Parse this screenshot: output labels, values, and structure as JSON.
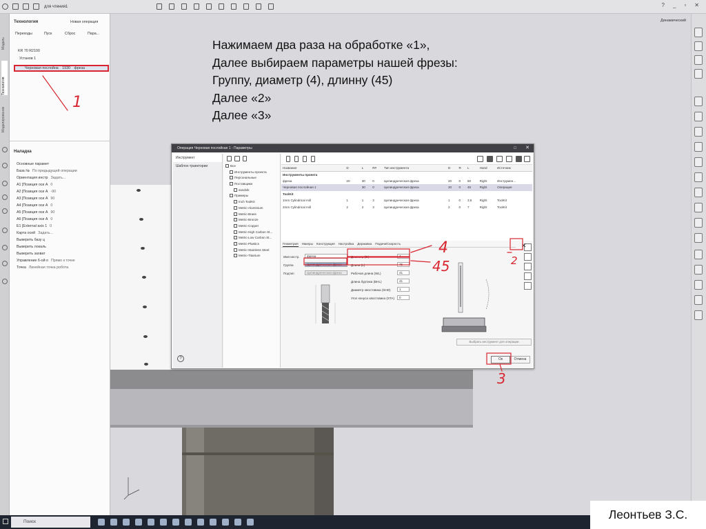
{
  "window": {
    "filename": "для чтения1",
    "mode_select": "Динамический"
  },
  "sidebar": {
    "tabs": [
      "Модель",
      "Технология",
      "Моделирование"
    ],
    "header": "Технология",
    "op_select": "Новая операция",
    "toolbar": [
      "Переходы",
      "Пуск",
      "Сброс",
      "Пара..."
    ],
    "tree": [
      "KR 70 R2100",
      "Установ 1",
      "Черновая послойна",
      "1930",
      "фреза"
    ],
    "setup_title": "Наладка",
    "setup_rows": [
      {
        "label": "Основные парамет",
        "value": ""
      },
      {
        "label": "База №",
        "value": "По предыдущей операции"
      },
      {
        "label": "Ориентация инстр",
        "value": "Задать..."
      },
      {
        "label": "A1 [Позиция оси A",
        "value": "0"
      },
      {
        "label": "A2 [Позиция оси A",
        "value": "-90"
      },
      {
        "label": "A3 [Позиция оси A",
        "value": "90"
      },
      {
        "label": "A4 [Позиция оси A",
        "value": "0"
      },
      {
        "label": "A5 [Позиция оси A",
        "value": "90"
      },
      {
        "label": "A6 [Позиция оси A",
        "value": "0"
      },
      {
        "label": "E1 [External axis 1",
        "value": "0"
      },
      {
        "label": "Карта осей",
        "value": "Задать..."
      },
      {
        "label": "Выверить базу ц",
        "value": ""
      },
      {
        "label": "Выверить локаль",
        "value": ""
      },
      {
        "label": "Выверить захват",
        "value": ""
      },
      {
        "label": "Управление 6-ой о",
        "value": "Прямо к точке"
      },
      {
        "label": "Точка",
        "value": "Линейная точка робота"
      }
    ]
  },
  "instructions": [
    "Нажимаем два раза на обработке «1»,",
    "Далее выбираем параметры нашей фрезы:",
    "Группу, диаметр (4), длинну (45)",
    "Далее «2»",
    "Далее «3»"
  ],
  "dialog": {
    "title": "Операция Черновая послойная 1 - Параметры",
    "left_items": [
      "Инструмент",
      "Шаблон траектории"
    ],
    "tree": [
      "Все",
      "Инструменты проекта",
      "Персональные",
      "Поставщики",
      "sandvik",
      "Примеры",
      "Inch ToolKit",
      "Metric-Aluminium",
      "Metric-Brass",
      "Metric-Bronze",
      "Metric-Copper",
      "Metric-High Carbon St...",
      "Metric-Low Carbon St...",
      "Metric-Plastics",
      "Metric-Stainless Steel",
      "Metric-Titanium"
    ],
    "columns": [
      "Название",
      "D",
      "",
      "L",
      "R#",
      "Тип инструмента",
      "D",
      "R",
      "L",
      "Hand",
      "Источник"
    ],
    "rows": [
      {
        "type": "grp",
        "cells": [
          "Инструменты проекта",
          "",
          "",
          "",
          "",
          "",
          "",
          "",
          "",
          "",
          ""
        ]
      },
      {
        "type": "row",
        "cells": [
          "фреза",
          "20",
          "",
          "30",
          "0",
          "Цилиндрическая фреза",
          "20",
          "0",
          "60",
          "Right",
          "Инструмен..."
        ]
      },
      {
        "type": "sel",
        "cells": [
          "Черновая послойная 1",
          "",
          "",
          "30",
          "0",
          "Цилиндрическая фреза",
          "20",
          "0",
          "45",
          "Right",
          "Операция"
        ]
      },
      {
        "type": "grp",
        "cells": [
          "ToolKit",
          "",
          "",
          "",
          "",
          "",
          "",
          "",
          "",
          "",
          ""
        ]
      },
      {
        "type": "row",
        "cells": [
          "1mm Cylindrical mill",
          "1",
          "",
          "1",
          "3",
          "Цилиндрическая фреза",
          "1",
          "0",
          "3.5",
          "Right",
          "ToolKit"
        ]
      },
      {
        "type": "row",
        "cells": [
          "2mm Cylindrical mill",
          "2",
          "",
          "2",
          "3",
          "Цилиндрическая фреза",
          "2",
          "0",
          "7",
          "Right",
          "ToolKit"
        ]
      }
    ],
    "tabs": [
      "Геометрия",
      "Накеры",
      "Конструкция",
      "Настройка",
      "Державка",
      "Подачи/Скорость"
    ],
    "params_left": [
      {
        "label": "Имя инстр.",
        "value": "фреза"
      },
      {
        "label": "Группа",
        "value": "Цилиндрическая фреза"
      },
      {
        "label": "Подтип",
        "value": "Цилиндрическая фреза"
      }
    ],
    "params_right": [
      {
        "label": "Диаметр (D)",
        "value": "4"
      },
      {
        "label": "Длина (L)",
        "value": "45"
      },
      {
        "label": "Рабочая длина (WL)",
        "value": "41"
      },
      {
        "label": "Длина буртика (BHL)",
        "value": "41"
      },
      {
        "label": "Диаметр хвостовика (SHD)",
        "value": "1"
      },
      {
        "label": "Угол конуса хвостовика (STA)",
        "value": "0"
      }
    ],
    "select_button": "Выбрать инструмент для операции",
    "ok": "Ок",
    "cancel": "Отмена",
    "help": "?"
  },
  "annotations": [
    "1",
    "4",
    "45",
    "2",
    "3"
  ],
  "taskbar": {
    "search": "Поиск"
  },
  "author": "Леонтьев З.С.",
  "colors": {
    "annotation": "#d9252f",
    "dialog_title": "#3f3f45",
    "viewport": "#d9d8dc"
  }
}
